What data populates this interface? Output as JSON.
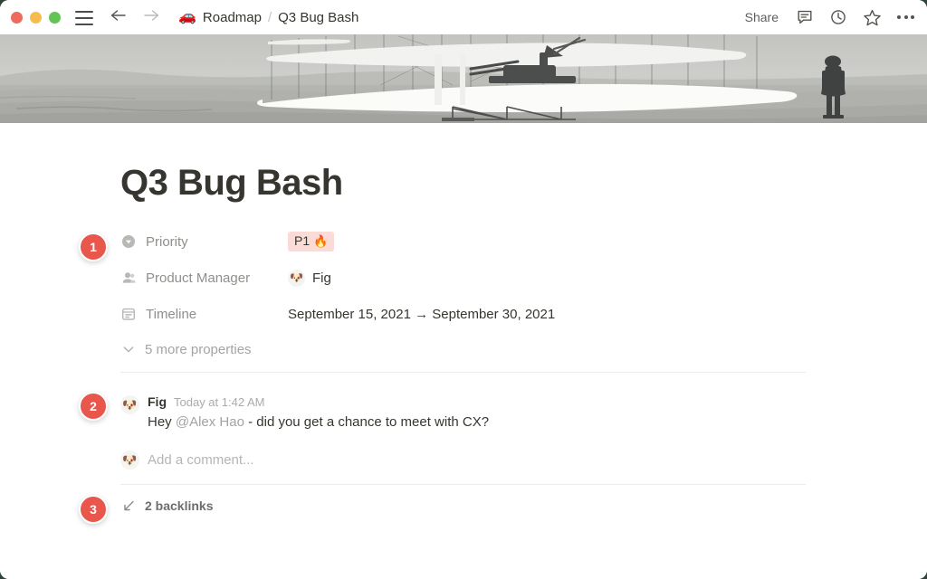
{
  "window": {
    "traffic_lights": [
      "close",
      "minimize",
      "maximize"
    ],
    "menu_icon": "hamburger-menu-icon",
    "back_icon": "arrow-left-icon",
    "forward_icon": "arrow-right-icon"
  },
  "breadcrumb": {
    "emoji": "🚗",
    "parent": "Roadmap",
    "separator": "/",
    "current": "Q3 Bug Bash"
  },
  "toolbar": {
    "share_label": "Share",
    "comment_icon": "comment-icon",
    "history_icon": "clock-icon",
    "favorite_icon": "star-icon",
    "more_icon": "ellipsis-icon"
  },
  "cover": {
    "alt": "vintage grayscale photo of Wright brothers biplane glider on sand flats with standing man"
  },
  "page": {
    "title": "Q3 Bug Bash"
  },
  "properties": [
    {
      "icon": "select-property-icon",
      "label": "Priority",
      "value_type": "tag",
      "value": "P1",
      "value_emoji": "🔥",
      "tag_bg": "#fbdbd6"
    },
    {
      "icon": "person-property-icon",
      "label": "Product Manager",
      "value_type": "person",
      "value": "Fig",
      "avatar_glyph": "🐶"
    },
    {
      "icon": "calendar-property-icon",
      "label": "Timeline",
      "value_type": "date-range",
      "value": "September 15, 2021 → September 30, 2021",
      "start_date": "September 15, 2021",
      "end_date": "September 30, 2021"
    }
  ],
  "more_properties": {
    "icon": "chevron-down-icon",
    "label": "5 more properties",
    "count": 5
  },
  "comments": [
    {
      "avatar_glyph": "🐶",
      "author": "Fig",
      "timestamp": "Today at 1:42 AM",
      "text_before_mention": "Hey ",
      "mention": "@Alex Hao",
      "text_after_mention": " - did you get a chance to meet with CX?"
    }
  ],
  "add_comment": {
    "avatar_glyph": "🐶",
    "placeholder": "Add a comment..."
  },
  "backlinks": {
    "icon": "arrow-down-left-icon",
    "label": "2 backlinks",
    "count": 2
  },
  "callouts": [
    {
      "number": "1",
      "target": "properties"
    },
    {
      "number": "2",
      "target": "comments"
    },
    {
      "number": "3",
      "target": "backlinks"
    }
  ],
  "colors": {
    "badge": "#e8564c",
    "tag_pink": "#fbdbd6",
    "text": "#37352f",
    "muted": "#908f8b",
    "desktop": "#2f4338"
  }
}
